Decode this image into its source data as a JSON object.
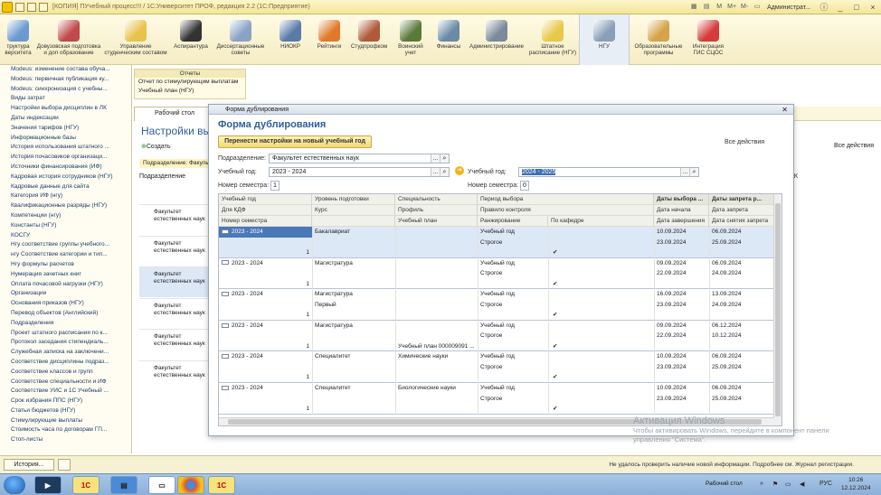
{
  "window": {
    "title": "[КОПИЯ] ПУчебный процесс!!! / 1С:Университет ПРОФ, редакция 2.2  (1С:Предприятие)",
    "user": "Администрат..."
  },
  "toolbar_icons": [
    "M",
    "M+",
    "M-"
  ],
  "sections": [
    {
      "label": "труктура\nверситета",
      "color": "#6a9ad0"
    },
    {
      "label": "Довузовская подготовка\nи доп образование",
      "color": "#c04a4a"
    },
    {
      "label": "Управление\nстуденческим составом",
      "color": "#e8c24a"
    },
    {
      "label": "Аспирантура",
      "color": "#333333"
    },
    {
      "label": "Диссертационные\nсоветы",
      "color": "#8aa2c4"
    },
    {
      "label": "НИОКР",
      "color": "#5a7aa8"
    },
    {
      "label": "Рейтинги",
      "color": "#e07a2a"
    },
    {
      "label": "Студпрофком",
      "color": "#b05a3a"
    },
    {
      "label": "Воинский\nучет",
      "color": "#5a7a3a"
    },
    {
      "label": "Финансы",
      "color": "#6a8aa6"
    },
    {
      "label": "Администрирование",
      "color": "#7a8a9a"
    },
    {
      "label": "Штатное\nрасписание (НГУ)",
      "color": "#e8c84a"
    },
    {
      "label": "НГУ",
      "color": "#8aa0b8"
    },
    {
      "label": "Образовательные\nпрограммы",
      "color": "#d6a24a"
    },
    {
      "label": "Интеграция\nГИС СЦОС",
      "color": "#d63a3a"
    }
  ],
  "sidebar": [
    "Modeus: изменение состава обуча...",
    "Modeus: первичная публикация ку...",
    "Modeus: синхронизация с учебны...",
    "Виды затрат",
    "Настройки выбора дисциплин в ЛК",
    "Даты индексации",
    "Значения тарифов (НГУ)",
    "Информационные базы",
    "История использования штатного ...",
    "История почасовиков организаци...",
    "Источники финансирования (ИФ)",
    "Кадровая история сотрудников (НГУ)",
    "Кадровые данные для сайта",
    "Категория ИФ (нгу)",
    "Квалификационные разряды (НГУ)",
    "Компетенции (нгу)",
    "Константы (НГУ)",
    "КОСГУ",
    "Нгу соответствие группы учебного...",
    "нгу Соответствие категории и тип...",
    "Нгу формулы расчетов",
    "Нумерация зачетных книг",
    "Оплата почасовой нагрузки (НГУ)",
    "Организации",
    "Основания приказов (НГУ)",
    "Перевод объектов (Английский)",
    "Подразделения",
    "Проект штатного расписания по к...",
    "Протокол заседания стипендиаль...",
    "Служебная записка на заключени...",
    "Соответствие дисциплины подраз...",
    "Соответствие классов и групп",
    "Соответствие специальности и ИФ",
    "Соответствие УИС и 1С Учебный ...",
    "Срок избрания ППС (НГУ)",
    "Статьи бюджетов (НГУ)",
    "Стимулирующие выплаты",
    "Стоимость часа по договорам ГП...",
    "Стоп-листы"
  ],
  "reports": {
    "header": "Отчеты",
    "items": [
      "Отчет по стимулирующим выплатам",
      "Учебный план (НГУ)"
    ]
  },
  "tabs": {
    "desktop": "Рабочий стол"
  },
  "background": {
    "title": "Настройки выбо",
    "create": "Создать",
    "subdiv": "Подразделение: Факульт",
    "col": "Подразделение",
    "all_actions": "Все действия",
    "k": "К",
    "rows": [
      "Факультет\nестественных наук",
      "Факультет\nестественных наук",
      "Факультет\nестественных наук",
      "Факультет\nестественных наук",
      "Факультет\nестественных наук",
      "Факультет\nестественных наук"
    ]
  },
  "dialog": {
    "window_title": "Форма дублирования",
    "form_title": "Форма дублирования",
    "transfer_button": "Перенести настройки на новый учебный год",
    "all_actions": "Все действия",
    "subdivision_label": "Подразделение:",
    "subdivision_value": "Факультет естественных наук",
    "year_label": "Учебный год:",
    "year_value": "2023 - 2024",
    "new_year_label": "Учебный год:",
    "new_year_value": "2024 - 2025",
    "semester_label": "Номер семестра:",
    "semester_value": "1",
    "new_semester_label": "Номер семестра:",
    "new_semester_value": "0"
  },
  "grid": {
    "headers": [
      [
        "Учебный год",
        "Уровень подготовки",
        "Специальность",
        "Период выбора",
        "",
        "Даты выбора ...",
        "Даты запрета  р..."
      ],
      [
        "Для КДФ",
        "Курс",
        "Профиль",
        "Правило контроля",
        "",
        "Дата начала",
        "Дата запрета"
      ],
      [
        "Номер семестра",
        "",
        "Учебный план",
        "Ранжирование",
        "По кафедре",
        "Дата завершения",
        "Дата снятия запрета"
      ]
    ],
    "rows": [
      {
        "year": "2023 - 2024",
        "level": "Бакалавриат",
        "course": "",
        "spec": "",
        "plan": "",
        "period": "Учебный год",
        "rule": "Строгое",
        "dept": "✔",
        "sem": "1",
        "d1": "10.09.2024",
        "d2": "23.09.2024",
        "z1": "06.09.2024",
        "z2": "25.09.2024"
      },
      {
        "year": "2023 - 2024",
        "level": "Магистратура",
        "course": "",
        "spec": "",
        "plan": "",
        "period": "Учебный год",
        "rule": "Строгое",
        "dept": "✔",
        "sem": "1",
        "d1": "09.09.2024",
        "d2": "22.09.2024",
        "z1": "06.09.2024",
        "z2": "24.09.2024"
      },
      {
        "year": "2023 - 2024",
        "level": "Магистратура",
        "course": "Первый",
        "spec": "",
        "plan": "",
        "period": "Учебный год",
        "rule": "Строгое",
        "dept": "✔",
        "sem": "1",
        "d1": "16.09.2024",
        "d2": "23.09.2024",
        "z1": "13.09.2024",
        "z2": "24.09.2024"
      },
      {
        "year": "2023 - 2024",
        "level": "Магистратура",
        "course": "",
        "spec": "",
        "plan": "Учебный план 000009091 ...",
        "period": "Учебный год",
        "rule": "Строгое",
        "dept": "✔",
        "sem": "1",
        "d1": "09.09.2024",
        "d2": "22.09.2024",
        "z1": "06.12.2024",
        "z2": "10.12.2024"
      },
      {
        "year": "2023 - 2024",
        "level": "Специалитет",
        "course": "",
        "spec": "Химические науки",
        "plan": "",
        "period": "Учебный год",
        "rule": "Строгое",
        "dept": "✔",
        "sem": "1",
        "d1": "10.09.2024",
        "d2": "23.09.2024",
        "z1": "06.09.2024",
        "z2": "25.09.2024"
      },
      {
        "year": "2023 - 2024",
        "level": "Специалитет",
        "course": "",
        "spec": "Биологические науки",
        "plan": "",
        "period": "Учебный год",
        "rule": "Строгое",
        "dept": "✔",
        "sem": "1",
        "d1": "10.09.2024",
        "d2": "23.09.2024",
        "z1": "06.09.2024",
        "z2": "25.09.2024"
      }
    ]
  },
  "watermark": {
    "line1": "Активация Windows",
    "line2": "Чтобы активировать Windows, перейдите в компонент панели управления \"Система\"."
  },
  "status": {
    "history": "История...",
    "message": "Не удалось проверить наличие новой информации. Подробнее см. Журнал регистрации."
  },
  "taskbar": {
    "desktop": "Рабочий стол",
    "lang": "РУС",
    "time": "10:26",
    "date": "12.12.2024",
    "app1": "1С",
    "app2": "1С"
  }
}
